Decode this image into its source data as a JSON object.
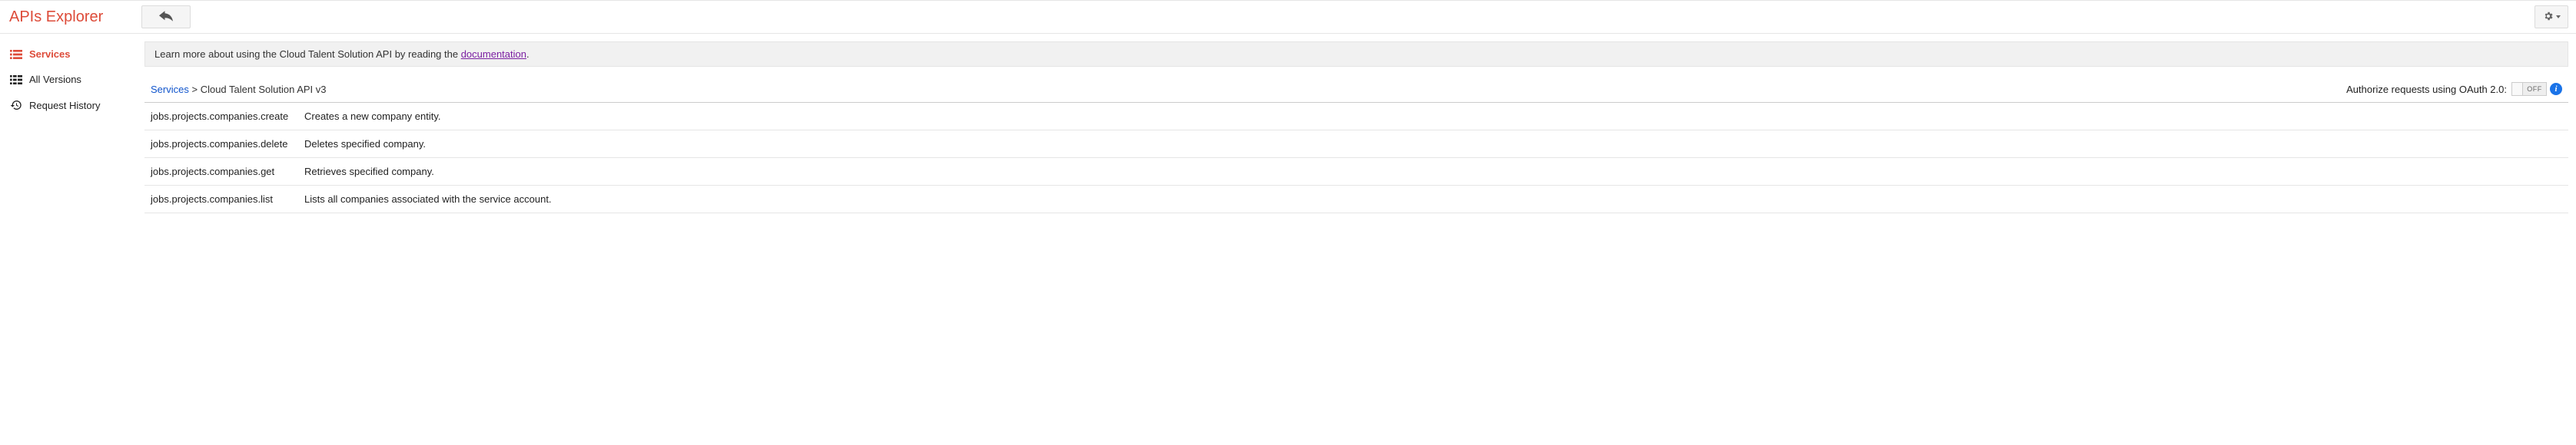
{
  "header": {
    "title": "APIs Explorer"
  },
  "sidebar": {
    "items": [
      {
        "label": "Services"
      },
      {
        "label": "All Versions"
      },
      {
        "label": "Request History"
      }
    ]
  },
  "info_bar": {
    "prefix": "Learn more about using the Cloud Talent Solution API by reading the ",
    "link_text": "documentation",
    "suffix": "."
  },
  "breadcrumb": {
    "root": "Services",
    "sep": " > ",
    "current": "Cloud Talent Solution API v3"
  },
  "oauth": {
    "label": "Authorize requests using OAuth 2.0:",
    "toggle_state": "OFF"
  },
  "methods": [
    {
      "name": "jobs.projects.companies.create",
      "desc": "Creates a new company entity."
    },
    {
      "name": "jobs.projects.companies.delete",
      "desc": "Deletes specified company."
    },
    {
      "name": "jobs.projects.companies.get",
      "desc": "Retrieves specified company."
    },
    {
      "name": "jobs.projects.companies.list",
      "desc": "Lists all companies associated with the service account."
    }
  ]
}
